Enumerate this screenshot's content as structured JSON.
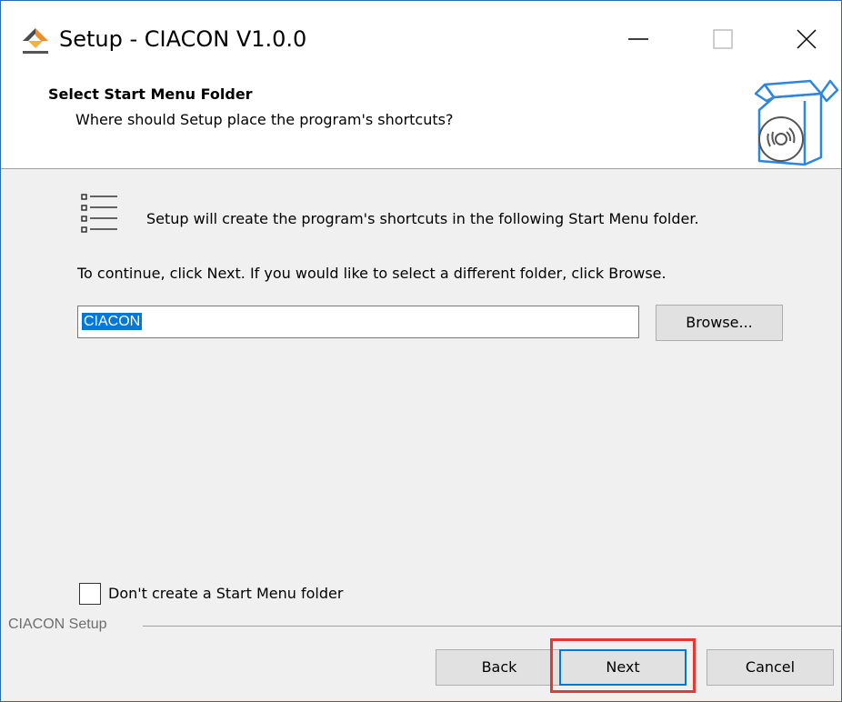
{
  "window": {
    "title": "Setup - CIACON V1.0.0"
  },
  "header": {
    "title": "Select Start Menu Folder",
    "subtitle": "Where should Setup place the program's shortcuts?"
  },
  "body": {
    "info_text": "Setup will create the program's shortcuts in the following Start Menu folder.",
    "continue_text": "To continue, click Next. If you would like to select a different folder, click Browse.",
    "folder_value": "CIACON",
    "browse_label": "Browse...",
    "checkbox_label": "Don't create a Start Menu folder",
    "checkbox_checked": false
  },
  "footer": {
    "group_label": "CIACON Setup",
    "back_label": "Back",
    "next_label": "Next",
    "cancel_label": "Cancel"
  },
  "icons": {
    "app": "ciacon-logo-icon",
    "minimize": "minimize-icon",
    "maximize": "maximize-icon",
    "close": "close-icon",
    "header": "software-box-icon",
    "list": "list-icon"
  },
  "colors": {
    "accent": "#0078d7",
    "highlight": "#e53935",
    "window_border": "#2b6cb0"
  }
}
